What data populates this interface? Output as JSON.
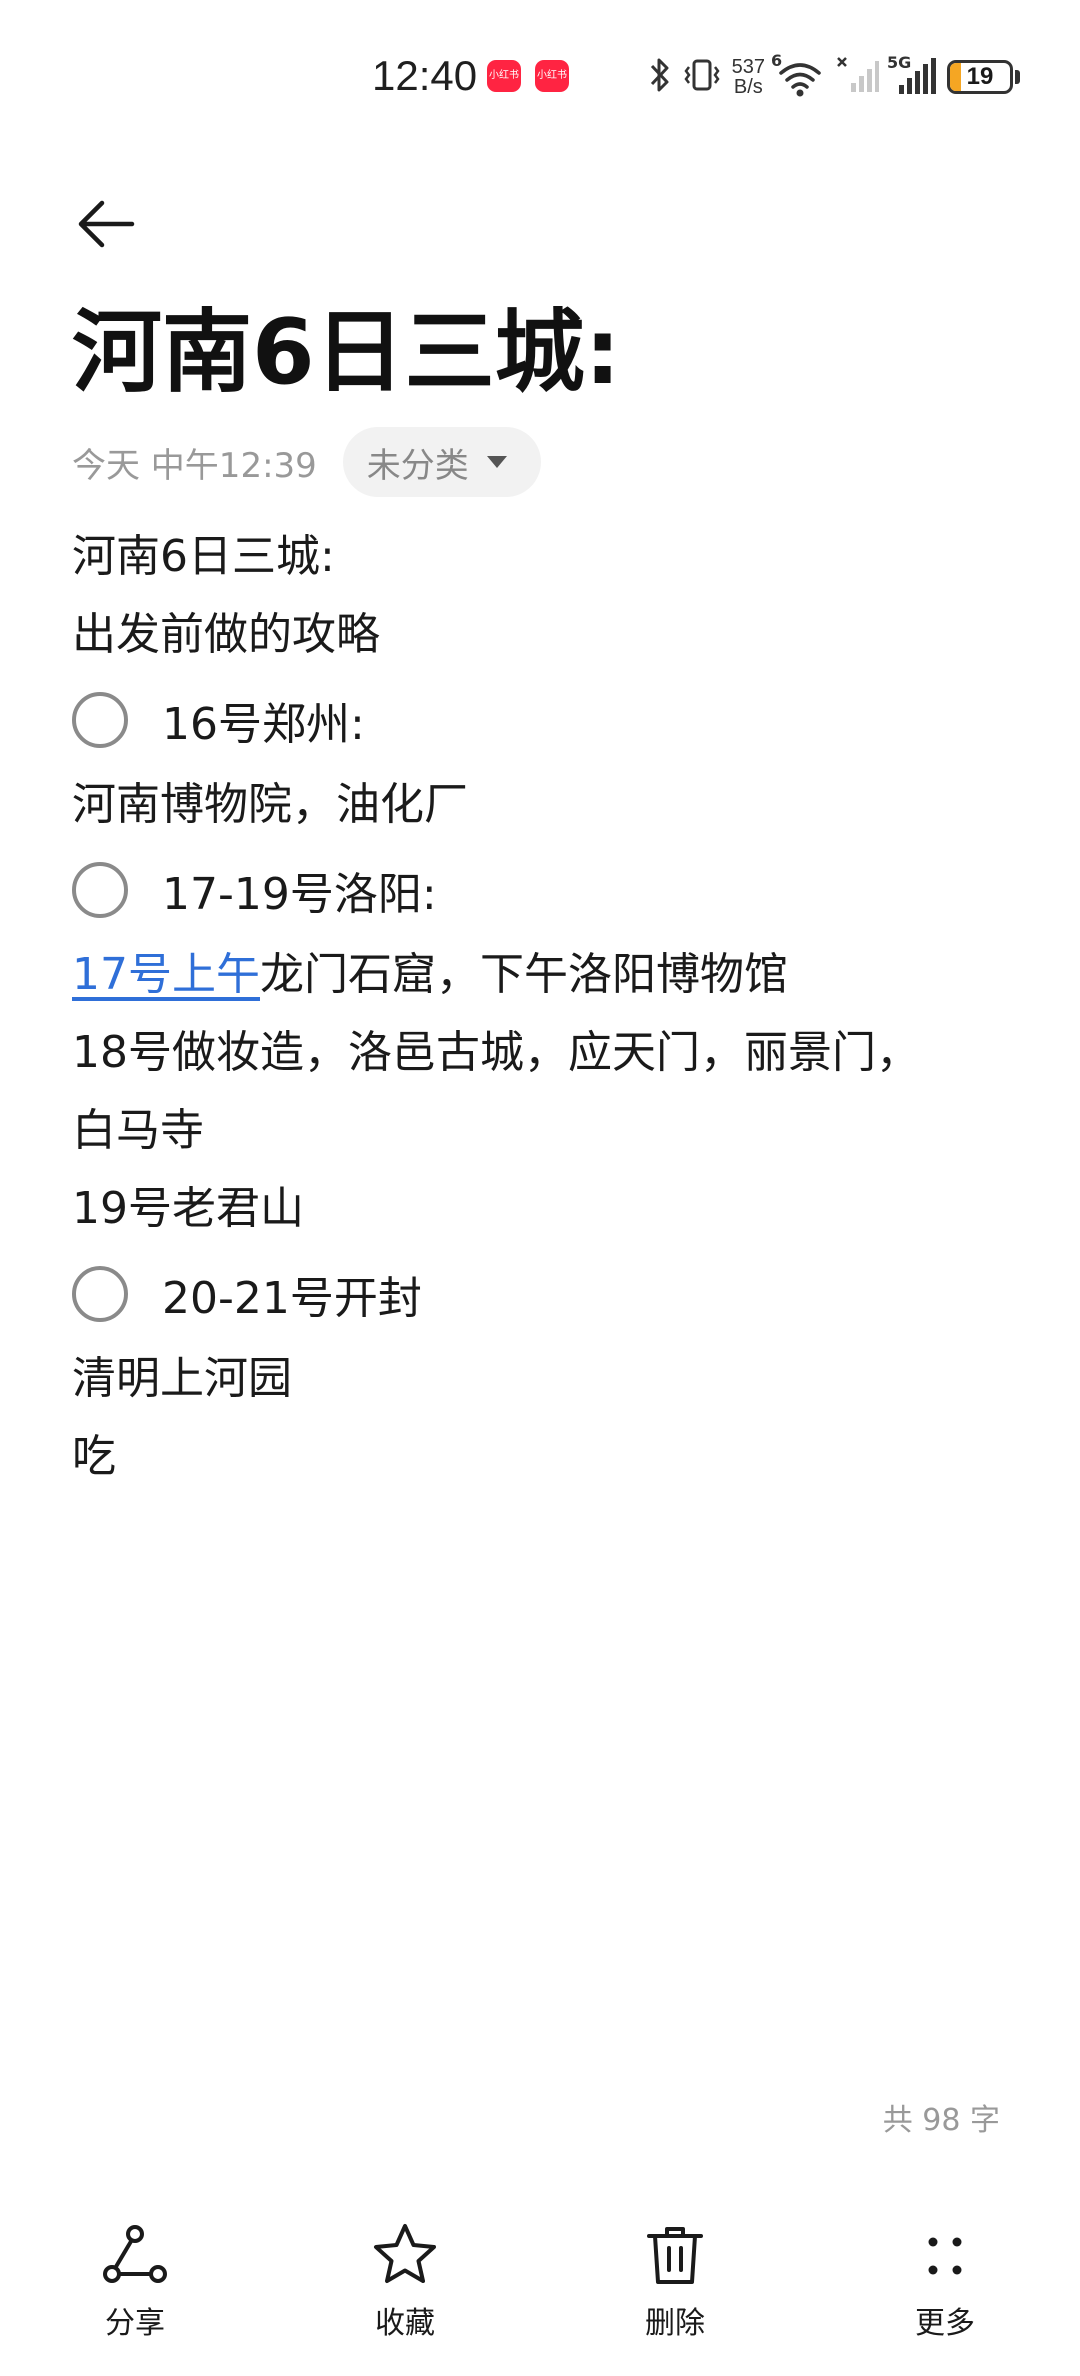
{
  "status_bar": {
    "time": "12:40",
    "app_badges": [
      "小红书",
      "小红书"
    ],
    "net_speed_value": "537",
    "net_speed_unit": "B/s",
    "wifi_badge": "6",
    "signal_label": "5G",
    "battery_level": "19",
    "battery_fraction": 0.19,
    "battery_color": "#f5a623"
  },
  "header": {
    "back_icon": "arrow-left-icon"
  },
  "note": {
    "title": "河南6日三城:",
    "date": "今天 中午12:39",
    "category": "未分类"
  },
  "content": {
    "line1": "河南6日三城:",
    "line2": "出发前做的攻略",
    "check1": "16号郑州:",
    "line3": "河南博物院，油化厂",
    "check2": "17-19号洛阳:",
    "line4_link": "17号上午",
    "line4_rest": "龙门石窟，下午洛阳博物馆",
    "line5": "18号做妆造，洛邑古城，应天门，丽景门，",
    "line6": "白马寺",
    "line7": "19号老君山",
    "check3": "20-21号开封",
    "line8": "清明上河园",
    "line9": "吃"
  },
  "footer": {
    "word_count": "共 98 字"
  },
  "toolbar": {
    "share_label": "分享",
    "favorite_label": "收藏",
    "delete_label": "删除",
    "more_label": "更多"
  },
  "colors": {
    "link": "#2f6fd8",
    "badge": "#ff2442"
  }
}
